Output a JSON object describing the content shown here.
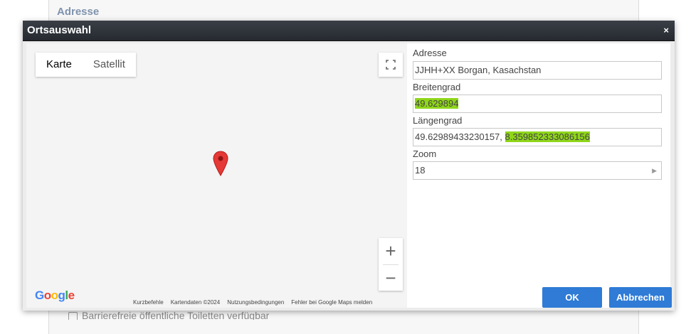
{
  "background": {
    "heading": "Adresse",
    "checkbox_label": "Barrierefreie öffentliche Toiletten verfügbar"
  },
  "dialog": {
    "title": "Ortsauswahl",
    "close_glyph": "×"
  },
  "map": {
    "map_type_buttons": [
      "Karte",
      "Satellit"
    ],
    "active_map_type": "Karte",
    "zoom_in_glyph": "+",
    "zoom_out_glyph": "−",
    "logo": "Google",
    "footer_links": [
      "Kurzbefehle",
      "Kartendaten ©2024",
      "Nutzungsbedingungen",
      "Fehler bei Google Maps melden"
    ],
    "pin_color": "#e53935"
  },
  "form": {
    "address_label": "Adresse",
    "address_value": "JJHH+XX Borgan, Kasachstan",
    "latitude_label": "Breitengrad",
    "latitude_value": "49.629894",
    "longitude_label": "Längengrad",
    "longitude_value_plain": "49.62989433230157, ",
    "longitude_value_highlight": "8.359852333086156",
    "zoom_label": "Zoom",
    "zoom_value": "18",
    "highlight_color": "#8fd61a"
  },
  "buttons": {
    "ok": "OK",
    "cancel": "Abbrechen",
    "accent_color": "#2f7bd6"
  }
}
